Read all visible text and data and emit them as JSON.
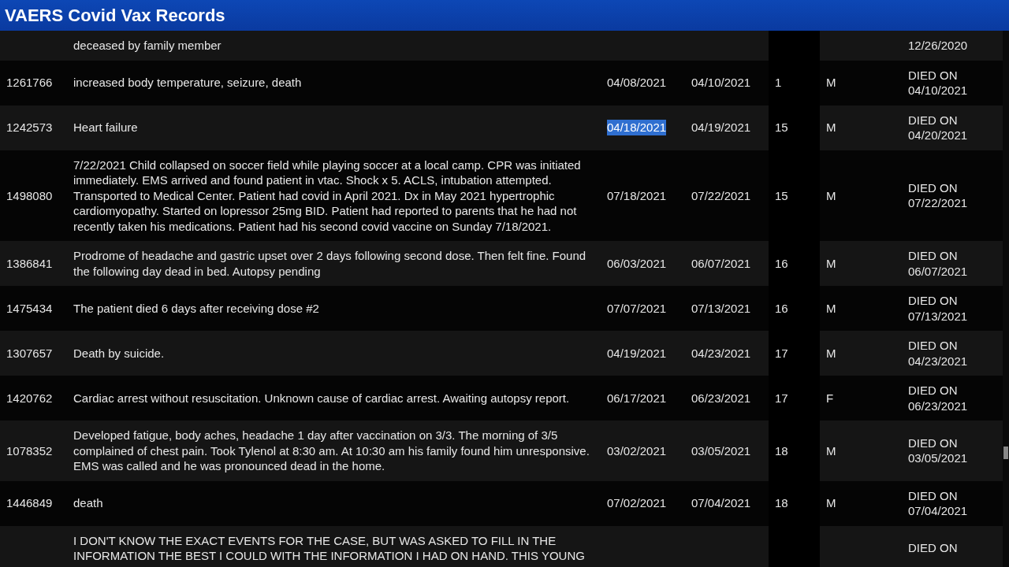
{
  "window": {
    "title": "VAERS Covid Vax Records"
  },
  "table": {
    "rows": [
      {
        "description": "deceased by family member",
        "outcome": "12/26/2020"
      },
      {
        "id": "1261766",
        "description": "increased body temperature, seizure, death",
        "vax_date": "04/08/2021",
        "died_date": "04/10/2021",
        "age": "1",
        "sex": "M",
        "outcome": "DIED ON 04/10/2021"
      },
      {
        "id": "1242573",
        "description": "Heart failure",
        "vax_date": "04/18/2021",
        "vax_date_highlighted": true,
        "died_date": "04/19/2021",
        "age": "15",
        "sex": "M",
        "outcome": "DIED ON 04/20/2021"
      },
      {
        "id": "1498080",
        "description": "7/22/2021 Child collapsed on soccer field while playing soccer at a local camp. CPR was initiated immediately. EMS arrived and found patient in vtac. Shock x 5. ACLS, intubation attempted. Transported to Medical Center. Patient had covid in April 2021. Dx in May 2021 hypertrophic cardiomyopathy. Started on lopressor 25mg BID. Patient had reported to parents that he had not recently taken his medications. Patient had his second covid vaccine on Sunday 7/18/2021.",
        "vax_date": "07/18/2021",
        "died_date": "07/22/2021",
        "age": "15",
        "sex": "M",
        "outcome": "DIED ON 07/22/2021"
      },
      {
        "id": "1386841",
        "description": "Prodrome of headache and gastric upset over 2 days following second dose. Then felt fine. Found the following day dead in bed. Autopsy pending",
        "vax_date": "06/03/2021",
        "died_date": "06/07/2021",
        "age": "16",
        "sex": "M",
        "outcome": "DIED ON 06/07/2021"
      },
      {
        "id": "1475434",
        "description": "The patient died 6 days after receiving dose #2",
        "vax_date": "07/07/2021",
        "died_date": "07/13/2021",
        "age": "16",
        "sex": "M",
        "outcome": "DIED ON 07/13/2021"
      },
      {
        "id": "1307657",
        "description": "Death by suicide.",
        "vax_date": "04/19/2021",
        "died_date": "04/23/2021",
        "age": "17",
        "sex": "M",
        "outcome": "DIED ON 04/23/2021"
      },
      {
        "id": "1420762",
        "description": "Cardiac arrest without resuscitation. Unknown cause of cardiac arrest. Awaiting autopsy report.",
        "vax_date": "06/17/2021",
        "died_date": "06/23/2021",
        "age": "17",
        "sex": "F",
        "outcome": "DIED ON 06/23/2021"
      },
      {
        "id": "1078352",
        "description": "Developed fatigue, body aches, headache 1 day after vaccination on 3/3. The morning of 3/5 complained of chest pain. Took Tylenol at 8:30 am. At 10:30 am his family found him unresponsive. EMS was called and he was pronounced dead in the home.",
        "vax_date": "03/02/2021",
        "died_date": "03/05/2021",
        "age": "18",
        "sex": "M",
        "outcome": "DIED ON 03/05/2021"
      },
      {
        "id": "1446849",
        "description": "death",
        "vax_date": "07/02/2021",
        "died_date": "07/04/2021",
        "age": "18",
        "sex": "M",
        "outcome": "DIED ON 07/04/2021"
      },
      {
        "description": "I DON'T KNOW THE EXACT EVENTS FOR THE CASE, BUT WAS ASKED TO FILL IN THE INFORMATION THE BEST I COULD WITH THE INFORMATION I HAD ON HAND. THIS YOUNG",
        "outcome": "DIED ON"
      }
    ]
  }
}
